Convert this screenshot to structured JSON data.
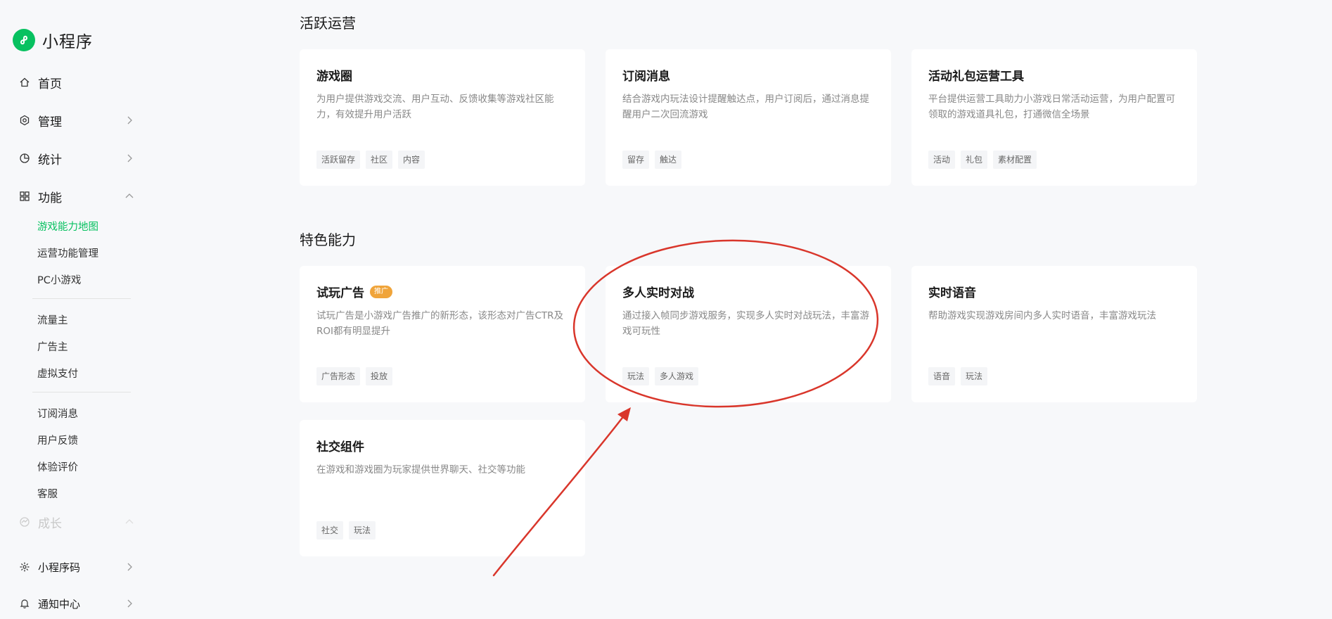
{
  "app": {
    "title": "小程序",
    "brand_color": "#07c160"
  },
  "sidebar": {
    "home": "首页",
    "manage": "管理",
    "stats": "统计",
    "features": "功能",
    "features_sub": [
      "游戏能力地图",
      "运营功能管理",
      "PC小游戏"
    ],
    "ads_sub": [
      "流量主",
      "广告主",
      "虚拟支付"
    ],
    "service_sub": [
      "订阅消息",
      "用户反馈",
      "体验评价",
      "客服"
    ],
    "growth": "成长",
    "qrcode": "小程序码",
    "notifications": "通知中心"
  },
  "sections": [
    {
      "title": "活跃运营",
      "cards": [
        {
          "title": "游戏圈",
          "desc": "为用户提供游戏交流、用户互动、反馈收集等游戏社区能力，有效提升用户活跃",
          "tags": [
            "活跃留存",
            "社区",
            "内容"
          ]
        },
        {
          "title": "订阅消息",
          "desc": "结合游戏内玩法设计提醒触达点，用户订阅后，通过消息提醒用户二次回流游戏",
          "tags": [
            "留存",
            "触达"
          ]
        },
        {
          "title": "活动礼包运营工具",
          "desc": "平台提供运营工具助力小游戏日常活动运营，为用户配置可领取的游戏道具礼包，打通微信全场景",
          "tags": [
            "活动",
            "礼包",
            "素材配置"
          ]
        }
      ]
    },
    {
      "title": "特色能力",
      "cards": [
        {
          "title": "试玩广告",
          "badge": "推广",
          "desc": "试玩广告是小游戏广告推广的新形态，该形态对广告CTR及ROI都有明显提升",
          "tags": [
            "广告形态",
            "投放"
          ]
        },
        {
          "title": "多人实时对战",
          "desc": "通过接入帧同步游戏服务，实现多人实时对战玩法，丰富游戏可玩性",
          "tags": [
            "玩法",
            "多人游戏"
          ]
        },
        {
          "title": "实时语音",
          "desc": "帮助游戏实现游戏房间内多人实时语音，丰富游戏玩法",
          "tags": [
            "语音",
            "玩法"
          ]
        },
        {
          "title": "社交组件",
          "desc": "在游戏和游戏圈为玩家提供世界聊天、社交等功能",
          "tags": [
            "社交",
            "玩法"
          ]
        }
      ]
    }
  ],
  "annotation_color": "#d9362b"
}
